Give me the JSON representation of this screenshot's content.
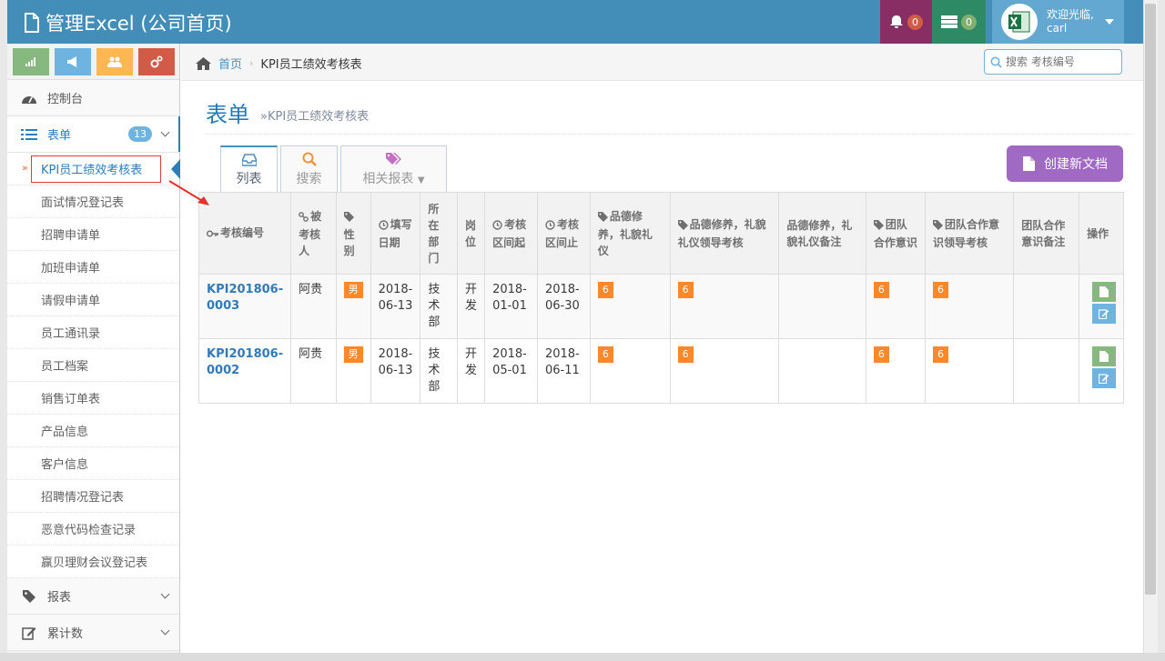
{
  "app": {
    "title": "管理Excel (公司首页)"
  },
  "navbar": {
    "bell_count": "0",
    "tasks_count": "0",
    "welcome": "欢迎光临,",
    "username": "carl"
  },
  "sidebar": {
    "items": [
      {
        "label": "控制台",
        "icon": "dashboard-icon"
      },
      {
        "label": "表单",
        "icon": "list-icon",
        "badge": "13"
      },
      {
        "label": "报表",
        "icon": "tag-icon"
      },
      {
        "label": "累计数",
        "icon": "edit-icon"
      }
    ],
    "subitems": [
      "KPI员工绩效考核表",
      "面试情况登记表",
      "招聘申请单",
      "加班申请单",
      "请假申请单",
      "员工通讯录",
      "员工档案",
      "销售订单表",
      "产品信息",
      "客户信息",
      "招聘情况登记表",
      "恶意代码检查记录",
      "赢贝理财会议登记表"
    ]
  },
  "breadcrumb": {
    "home": "首页",
    "current": "KPI员工绩效考核表"
  },
  "search": {
    "placeholder": "搜索 考核编号"
  },
  "page": {
    "title": "表单",
    "subtitle": "»KPI员工绩效考核表"
  },
  "tabs": [
    {
      "label": "列表",
      "icon": "inbox-icon"
    },
    {
      "label": "搜索",
      "icon": "search-icon"
    },
    {
      "label": "相关报表",
      "icon": "tags-icon"
    }
  ],
  "create_button": "创建新文档",
  "table": {
    "headers": [
      "考核编号",
      "被考核人",
      "性别",
      "填写日期",
      "所在部门",
      "岗位",
      "考核区间起",
      "考核区间止",
      "品德修养，礼貌礼仪",
      "品德修养，礼貌礼仪领导考核",
      "品德修养，礼貌礼仪备注",
      "团队合作意识",
      "团队合作意识领导考核",
      "团队合作意识备注",
      "操作"
    ],
    "rows": [
      {
        "id": "KPI201806-0003",
        "person": "阿贵",
        "gender": "男",
        "date": "2018-06-13",
        "dept": "技术部",
        "post": "开发",
        "start": "2018-01-01",
        "end": "2018-06-30",
        "s1": "6",
        "s2": "6",
        "s3": "",
        "s4": "6",
        "s5": "6",
        "s6": ""
      },
      {
        "id": "KPI201806-0002",
        "person": "阿贵",
        "gender": "男",
        "date": "2018-06-13",
        "dept": "技术部",
        "post": "开发",
        "start": "2018-05-01",
        "end": "2018-06-11",
        "s1": "6",
        "s2": "6",
        "s3": "",
        "s4": "6",
        "s5": "6",
        "s6": ""
      }
    ]
  },
  "colors": {
    "navbar": "#438eb9",
    "accent": "#2b7dbc",
    "create": "#a069c3",
    "score": "#ff892a"
  }
}
